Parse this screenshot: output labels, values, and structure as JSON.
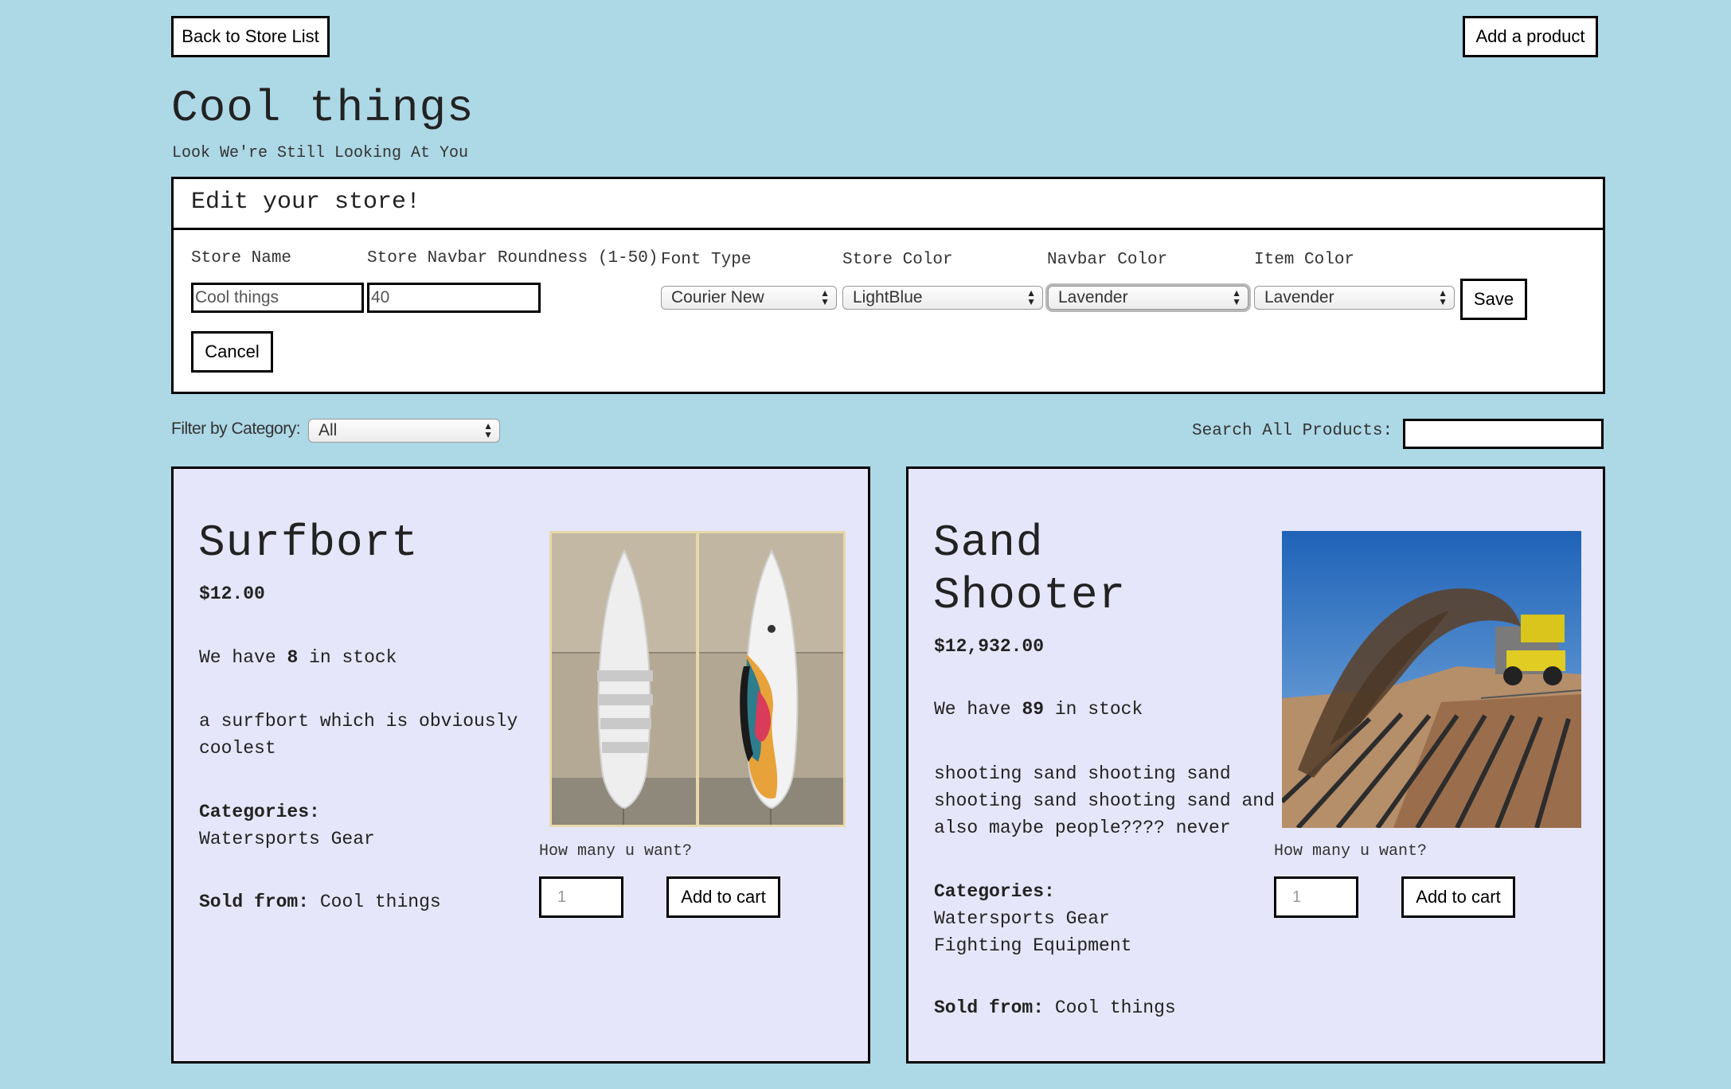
{
  "nav": {
    "back_label": "Back to Store List",
    "add_label": "Add a product"
  },
  "store": {
    "title": "Cool things",
    "subtitle": "Look We're Still Looking At You"
  },
  "edit": {
    "heading": "Edit your store!",
    "labels": {
      "name": "Store Name",
      "roundness": "Store Navbar Roundness (1-50)",
      "font": "Font Type",
      "store_color": "Store Color",
      "navbar_color": "Navbar Color",
      "item_color": "Item Color"
    },
    "values": {
      "name": "Cool things",
      "roundness": "40",
      "font": "Courier New",
      "store_color": "LightBlue",
      "navbar_color": "Lavender",
      "item_color": "Lavender"
    },
    "save_label": "Save",
    "cancel_label": "Cancel"
  },
  "filter": {
    "label": "Filter by Category:",
    "value": "All",
    "search_label": "Search All Products:",
    "search_value": ""
  },
  "products": [
    {
      "name": "Surfbort",
      "price": "$12.00",
      "stock_prefix": "We have",
      "stock": "8",
      "stock_suffix": "in stock",
      "description": "a surfbort which is obviously coolest",
      "categories_label": "Categories:",
      "categories": [
        "Watersports Gear"
      ],
      "sold_label": "Sold from:",
      "sold_from": "Cool things",
      "qty_label": "How many u want?",
      "qty_placeholder": "1",
      "cart_label": "Add to cart",
      "image_icon": "surfboard-photo"
    },
    {
      "name": "Sand Shooter",
      "name_lines": [
        "Sand",
        "Shooter"
      ],
      "price": "$12,932.00",
      "stock_prefix": "We have",
      "stock": "89",
      "stock_suffix": "in stock",
      "description_lines": [
        "shooting sand shooting sand",
        "shooting sand shooting sand and",
        "also maybe people???? never"
      ],
      "categories_label": "Categories:",
      "categories": [
        "Watersports Gear",
        "Fighting Equipment"
      ],
      "sold_label": "Sold from:",
      "sold_from": "Cool things",
      "qty_label": "How many u want?",
      "qty_placeholder": "1",
      "cart_label": "Add to cart",
      "image_icon": "sand-shooter-photo"
    }
  ],
  "colors": {
    "store_bg": "#add8e6",
    "item_bg": "#e6e6fa"
  }
}
